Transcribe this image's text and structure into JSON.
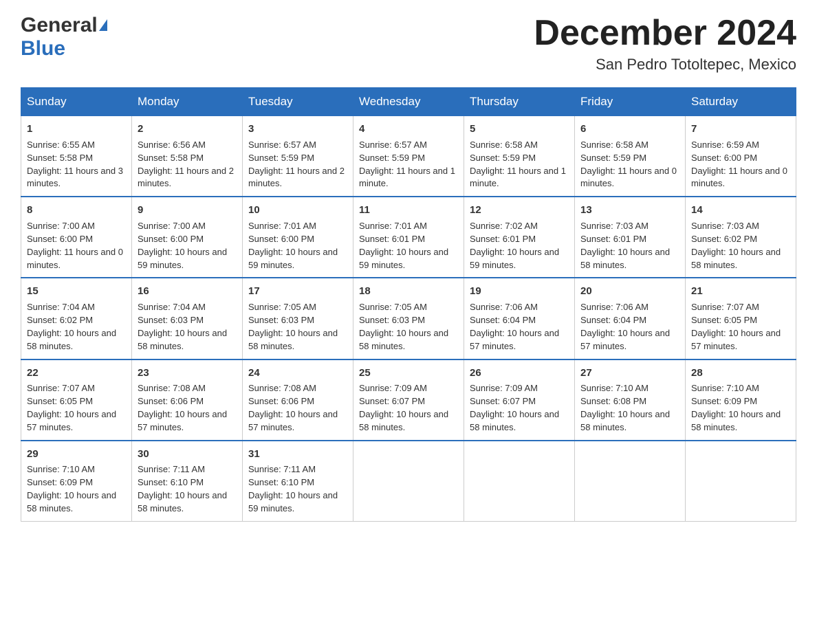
{
  "header": {
    "logo_general": "General",
    "logo_blue": "Blue",
    "month_title": "December 2024",
    "location": "San Pedro Totoltepec, Mexico"
  },
  "days_of_week": [
    "Sunday",
    "Monday",
    "Tuesday",
    "Wednesday",
    "Thursday",
    "Friday",
    "Saturday"
  ],
  "weeks": [
    [
      {
        "num": "1",
        "sunrise": "6:55 AM",
        "sunset": "5:58 PM",
        "daylight": "11 hours and 3 minutes."
      },
      {
        "num": "2",
        "sunrise": "6:56 AM",
        "sunset": "5:58 PM",
        "daylight": "11 hours and 2 minutes."
      },
      {
        "num": "3",
        "sunrise": "6:57 AM",
        "sunset": "5:59 PM",
        "daylight": "11 hours and 2 minutes."
      },
      {
        "num": "4",
        "sunrise": "6:57 AM",
        "sunset": "5:59 PM",
        "daylight": "11 hours and 1 minute."
      },
      {
        "num": "5",
        "sunrise": "6:58 AM",
        "sunset": "5:59 PM",
        "daylight": "11 hours and 1 minute."
      },
      {
        "num": "6",
        "sunrise": "6:58 AM",
        "sunset": "5:59 PM",
        "daylight": "11 hours and 0 minutes."
      },
      {
        "num": "7",
        "sunrise": "6:59 AM",
        "sunset": "6:00 PM",
        "daylight": "11 hours and 0 minutes."
      }
    ],
    [
      {
        "num": "8",
        "sunrise": "7:00 AM",
        "sunset": "6:00 PM",
        "daylight": "11 hours and 0 minutes."
      },
      {
        "num": "9",
        "sunrise": "7:00 AM",
        "sunset": "6:00 PM",
        "daylight": "10 hours and 59 minutes."
      },
      {
        "num": "10",
        "sunrise": "7:01 AM",
        "sunset": "6:00 PM",
        "daylight": "10 hours and 59 minutes."
      },
      {
        "num": "11",
        "sunrise": "7:01 AM",
        "sunset": "6:01 PM",
        "daylight": "10 hours and 59 minutes."
      },
      {
        "num": "12",
        "sunrise": "7:02 AM",
        "sunset": "6:01 PM",
        "daylight": "10 hours and 59 minutes."
      },
      {
        "num": "13",
        "sunrise": "7:03 AM",
        "sunset": "6:01 PM",
        "daylight": "10 hours and 58 minutes."
      },
      {
        "num": "14",
        "sunrise": "7:03 AM",
        "sunset": "6:02 PM",
        "daylight": "10 hours and 58 minutes."
      }
    ],
    [
      {
        "num": "15",
        "sunrise": "7:04 AM",
        "sunset": "6:02 PM",
        "daylight": "10 hours and 58 minutes."
      },
      {
        "num": "16",
        "sunrise": "7:04 AM",
        "sunset": "6:03 PM",
        "daylight": "10 hours and 58 minutes."
      },
      {
        "num": "17",
        "sunrise": "7:05 AM",
        "sunset": "6:03 PM",
        "daylight": "10 hours and 58 minutes."
      },
      {
        "num": "18",
        "sunrise": "7:05 AM",
        "sunset": "6:03 PM",
        "daylight": "10 hours and 58 minutes."
      },
      {
        "num": "19",
        "sunrise": "7:06 AM",
        "sunset": "6:04 PM",
        "daylight": "10 hours and 57 minutes."
      },
      {
        "num": "20",
        "sunrise": "7:06 AM",
        "sunset": "6:04 PM",
        "daylight": "10 hours and 57 minutes."
      },
      {
        "num": "21",
        "sunrise": "7:07 AM",
        "sunset": "6:05 PM",
        "daylight": "10 hours and 57 minutes."
      }
    ],
    [
      {
        "num": "22",
        "sunrise": "7:07 AM",
        "sunset": "6:05 PM",
        "daylight": "10 hours and 57 minutes."
      },
      {
        "num": "23",
        "sunrise": "7:08 AM",
        "sunset": "6:06 PM",
        "daylight": "10 hours and 57 minutes."
      },
      {
        "num": "24",
        "sunrise": "7:08 AM",
        "sunset": "6:06 PM",
        "daylight": "10 hours and 57 minutes."
      },
      {
        "num": "25",
        "sunrise": "7:09 AM",
        "sunset": "6:07 PM",
        "daylight": "10 hours and 58 minutes."
      },
      {
        "num": "26",
        "sunrise": "7:09 AM",
        "sunset": "6:07 PM",
        "daylight": "10 hours and 58 minutes."
      },
      {
        "num": "27",
        "sunrise": "7:10 AM",
        "sunset": "6:08 PM",
        "daylight": "10 hours and 58 minutes."
      },
      {
        "num": "28",
        "sunrise": "7:10 AM",
        "sunset": "6:09 PM",
        "daylight": "10 hours and 58 minutes."
      }
    ],
    [
      {
        "num": "29",
        "sunrise": "7:10 AM",
        "sunset": "6:09 PM",
        "daylight": "10 hours and 58 minutes."
      },
      {
        "num": "30",
        "sunrise": "7:11 AM",
        "sunset": "6:10 PM",
        "daylight": "10 hours and 58 minutes."
      },
      {
        "num": "31",
        "sunrise": "7:11 AM",
        "sunset": "6:10 PM",
        "daylight": "10 hours and 59 minutes."
      },
      {
        "num": "",
        "sunrise": "",
        "sunset": "",
        "daylight": ""
      },
      {
        "num": "",
        "sunrise": "",
        "sunset": "",
        "daylight": ""
      },
      {
        "num": "",
        "sunrise": "",
        "sunset": "",
        "daylight": ""
      },
      {
        "num": "",
        "sunrise": "",
        "sunset": "",
        "daylight": ""
      }
    ]
  ]
}
